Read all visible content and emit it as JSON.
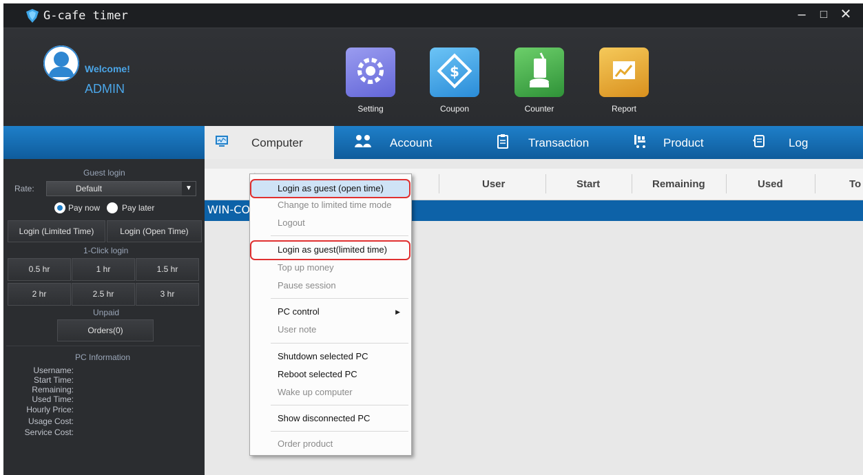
{
  "window": {
    "title": "G-cafe timer",
    "controls": [
      "–",
      "□",
      "✕"
    ]
  },
  "header": {
    "welcome": "Welcome!",
    "user": "ADMIN",
    "tools": [
      {
        "label": "Setting",
        "icon": "settings-icon",
        "color": "#7b7fe6"
      },
      {
        "label": "Coupon",
        "icon": "coupon-icon",
        "color": "#3ea6e8"
      },
      {
        "label": "Counter",
        "icon": "counter-icon",
        "color": "#3fa84a"
      },
      {
        "label": "Report",
        "icon": "report-icon",
        "color": "#e6a92e"
      }
    ]
  },
  "left": {
    "guest_login_title": "Guest login",
    "rate_label": "Rate:",
    "rate_value": "Default",
    "pay_now": "Pay now",
    "pay_later": "Pay later",
    "login_limited": "Login (Limited Time)",
    "login_open": "Login (Open Time)",
    "one_click_title": "1-Click login",
    "durations": [
      "0.5 hr",
      "1 hr",
      "1.5 hr",
      "2 hr",
      "2.5 hr",
      "3 hr"
    ],
    "unpaid_title": "Unpaid",
    "orders": "Orders(0)",
    "pc_info_title": "PC Information",
    "info_labels": [
      "Username:",
      "Start Time:",
      "Remaining:",
      "Used Time:",
      "Hourly Price:",
      "Usage Cost:",
      "Service Cost:"
    ]
  },
  "tabs": [
    {
      "label": "Computer",
      "icon": "monitor-icon",
      "active": true
    },
    {
      "label": "Account",
      "icon": "users-icon",
      "active": false
    },
    {
      "label": "Transaction",
      "icon": "clipboard-icon",
      "active": false
    },
    {
      "label": "Product",
      "icon": "cart-icon",
      "active": false
    },
    {
      "label": "Log",
      "icon": "log-icon",
      "active": false
    }
  ],
  "table": {
    "columns": [
      "User",
      "Start",
      "Remaining",
      "Used",
      "To"
    ],
    "selected_row": "WIN-CO"
  },
  "context_menu": {
    "items": [
      {
        "label": "Login as guest (open time)",
        "enabled": true,
        "highlighted": true
      },
      {
        "label": "Change to limited time mode",
        "enabled": false
      },
      {
        "label": "Logout",
        "enabled": false
      },
      {
        "label": "Login as guest(limited time)",
        "enabled": true
      },
      {
        "label": "Top up money",
        "enabled": false
      },
      {
        "label": "Pause session",
        "enabled": false
      },
      {
        "label": "PC control",
        "enabled": true,
        "submenu": true
      },
      {
        "label": "User note",
        "enabled": false
      },
      {
        "label": "Shutdown selected PC",
        "enabled": true
      },
      {
        "label": "Reboot selected PC",
        "enabled": true
      },
      {
        "label": "Wake up computer",
        "enabled": false
      },
      {
        "label": "Show disconnected PC",
        "enabled": true
      },
      {
        "label": "Order product",
        "enabled": false
      }
    ]
  },
  "colors": {
    "accent": "#1e7fc9",
    "selected_row": "#0d62a8",
    "highlight_box": "#e03030"
  }
}
